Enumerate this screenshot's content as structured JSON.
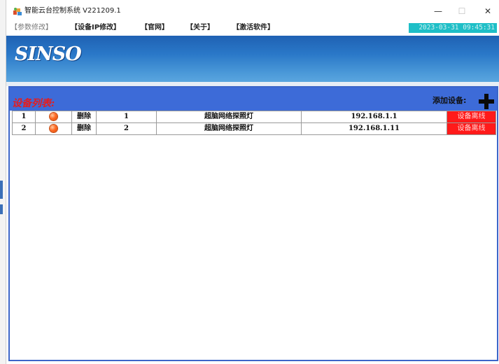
{
  "window": {
    "title": "智能云台控制系统 V221209.1",
    "min_glyph": "—",
    "max_glyph": "☐",
    "close_glyph": "✕"
  },
  "menu": {
    "params": "【参数修改】",
    "device_ip": "【设备IP修改】",
    "website": "【官网】",
    "about": "【关于】",
    "activate": "【激活软件】"
  },
  "datetime": "2023-03-31 09:45:31",
  "logo_text": "SINSO",
  "device_list": {
    "title": "设备列表:",
    "add_label": "添加设备:",
    "rows": [
      {
        "index": "1",
        "delete_label": "删除",
        "id": "1",
        "name": "超脑网络探照灯",
        "ip": "192.168.1.1",
        "status": "设备离线",
        "led_color": "#ff6a24"
      },
      {
        "index": "2",
        "delete_label": "删除",
        "id": "2",
        "name": "超脑网络探照灯",
        "ip": "192.168.1.11",
        "status": "设备离线",
        "led_color": "#ff6a24"
      }
    ]
  },
  "colors": {
    "banner": "#2a78c8",
    "panel_header": "#3d6bd8",
    "status_offline": "#ff1a1a",
    "datetime_bg": "#1fbfc7",
    "list_title": "#e61c1c"
  },
  "icons": {
    "app": "app-icon",
    "add": "plus-icon",
    "led": "status-led-icon"
  }
}
